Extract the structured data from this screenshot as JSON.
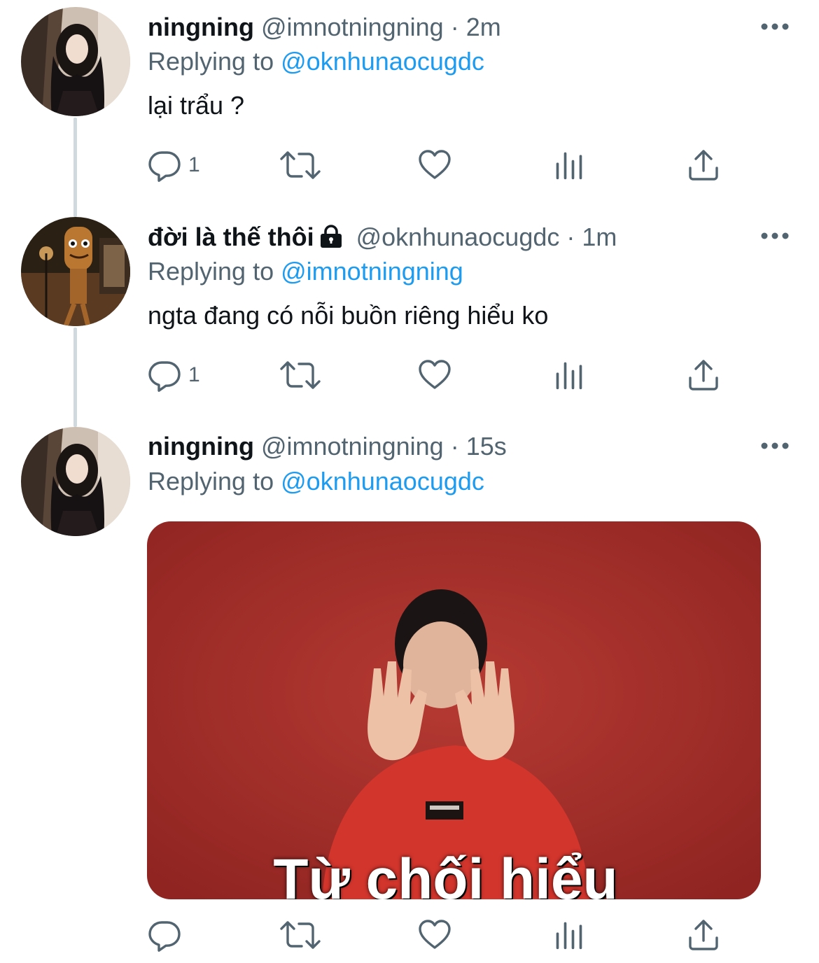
{
  "tweets": [
    {
      "name": "ningning",
      "handle": "@imnotningning",
      "separator": "·",
      "time": "2m",
      "replying_prefix": "Replying to",
      "replying_to": "@oknhunaocugdc",
      "text": "lại trẩu ?",
      "reply_count": "1",
      "avatar_icon": "avatar-girl-photo"
    },
    {
      "name": "đời là thế thôi",
      "locked": true,
      "handle": "@oknhunaocugdc",
      "separator": "·",
      "time": "1m",
      "replying_prefix": "Replying to",
      "replying_to": "@imnotningning",
      "text": "ngta đang có nỗi buồn riêng hiểu ko",
      "reply_count": "1",
      "avatar_icon": "avatar-figure-photo"
    },
    {
      "name": "ningning",
      "handle": "@imnotningning",
      "separator": "·",
      "time": "15s",
      "replying_prefix": "Replying to",
      "replying_to": "@oknhunaocugdc",
      "media_caption": "Từ chối hiểu",
      "avatar_icon": "avatar-girl-photo"
    }
  ],
  "colors": {
    "text_primary": "#0f1419",
    "text_secondary": "#536471",
    "link": "#1d9bf0",
    "thread_line": "#cfd9de",
    "media_background": "#b0302a"
  },
  "icons": [
    "reply-icon",
    "retweet-icon",
    "like-icon",
    "views-icon",
    "share-icon",
    "more-icon",
    "lock-icon"
  ]
}
